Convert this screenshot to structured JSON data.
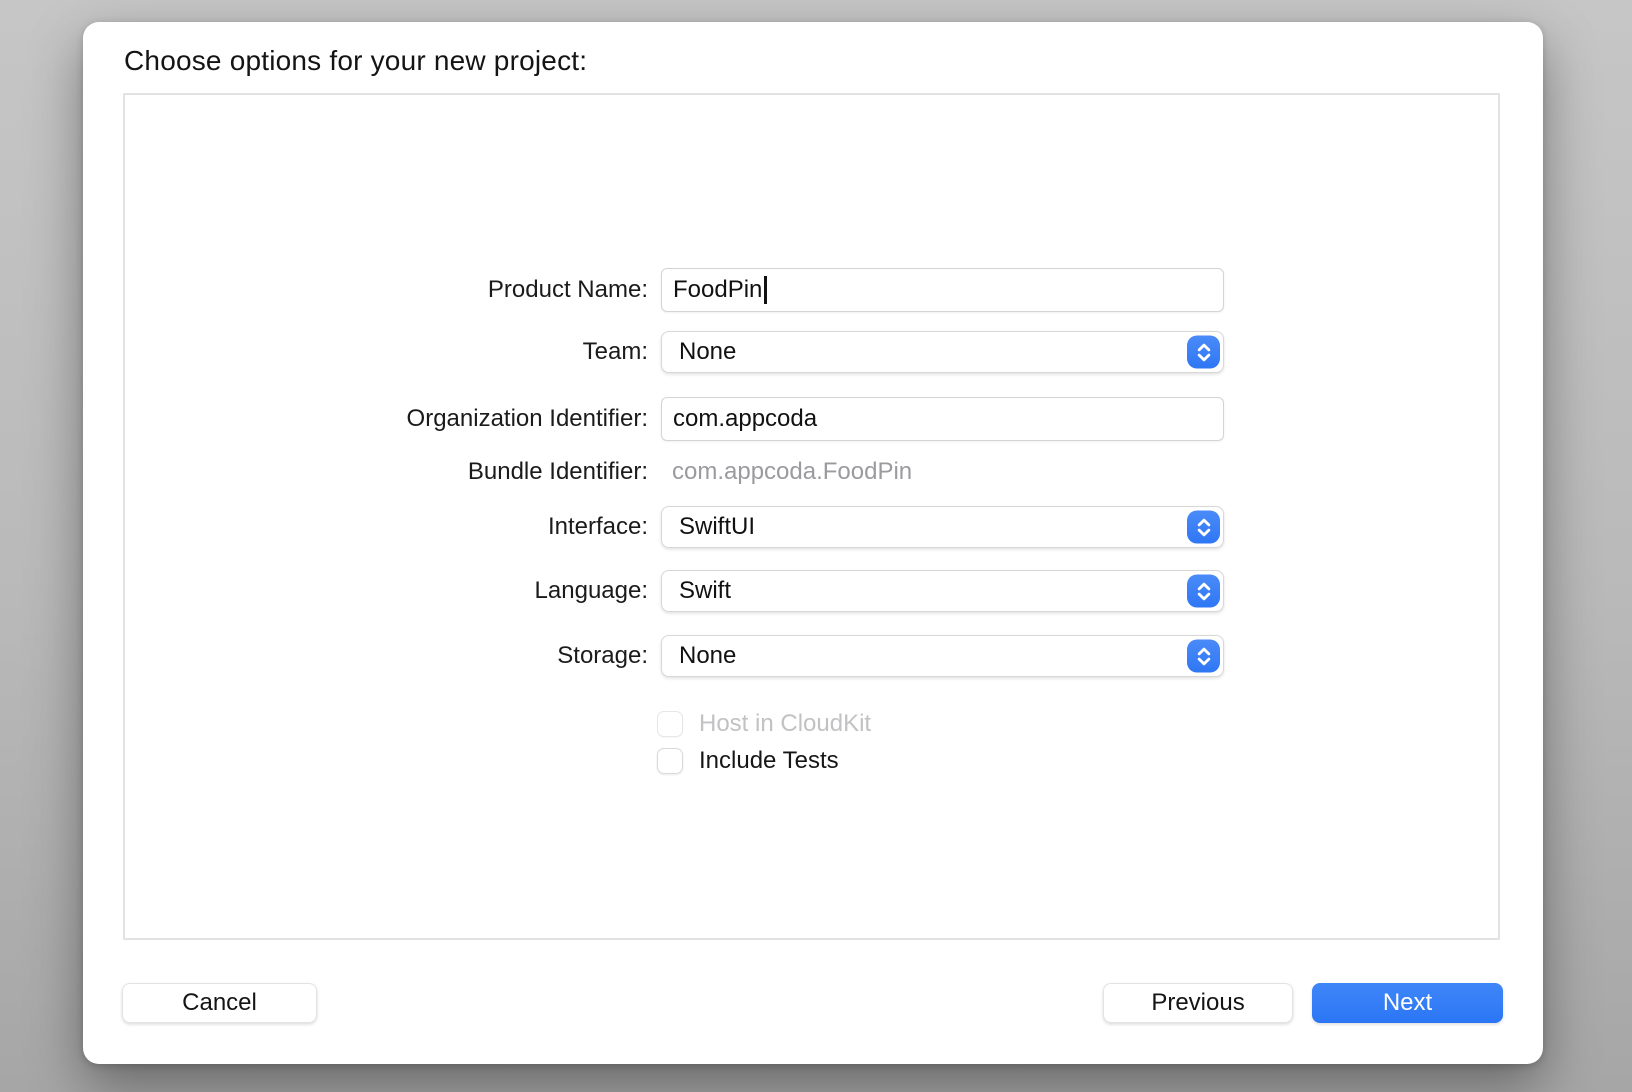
{
  "dialog": {
    "title": "Choose options for your new project:",
    "form": {
      "product_name": {
        "label": "Product Name:",
        "value": "FoodPin"
      },
      "team": {
        "label": "Team:",
        "value": "None"
      },
      "organization_identifier": {
        "label": "Organization Identifier:",
        "value": "com.appcoda"
      },
      "bundle_identifier": {
        "label": "Bundle Identifier:",
        "value": "com.appcoda.FoodPin"
      },
      "interface": {
        "label": "Interface:",
        "value": "SwiftUI"
      },
      "language": {
        "label": "Language:",
        "value": "Swift"
      },
      "storage": {
        "label": "Storage:",
        "value": "None"
      },
      "host_in_cloudkit": {
        "label": "Host in CloudKit",
        "checked": false,
        "enabled": false
      },
      "include_tests": {
        "label": "Include Tests",
        "checked": false,
        "enabled": true
      }
    },
    "buttons": {
      "cancel": "Cancel",
      "previous": "Previous",
      "next": "Next"
    },
    "colors": {
      "accent_blue": "#2e77f4",
      "disabled_text": "#c2c2c4",
      "muted_text": "#9b9b9f"
    }
  }
}
